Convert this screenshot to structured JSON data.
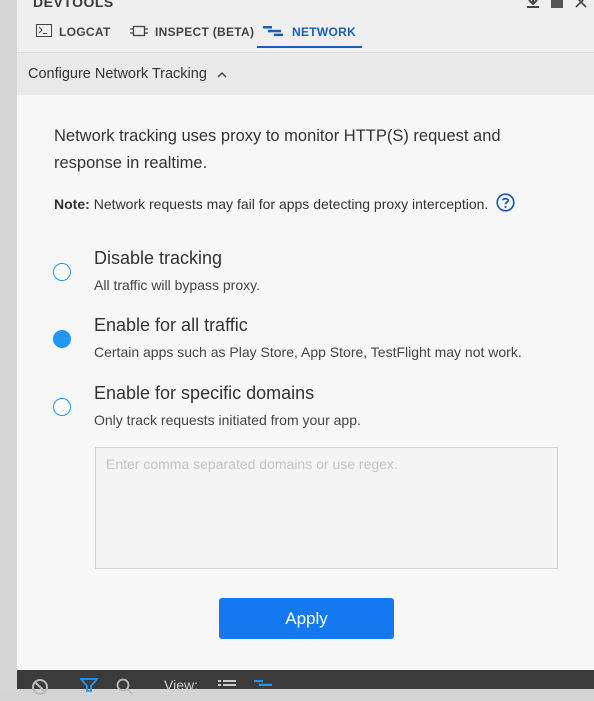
{
  "window": {
    "title": "DEVTOOLS",
    "controls": [
      "download-icon",
      "maximize-icon",
      "close-icon"
    ]
  },
  "tabs": [
    {
      "label": "LOGCAT",
      "icon": "terminal-icon",
      "active": false
    },
    {
      "label": "INSPECT (BETA)",
      "icon": "chip-icon",
      "active": false
    },
    {
      "label": "NETWORK",
      "icon": "network-icon",
      "active": true
    }
  ],
  "config": {
    "header": "Configure Network Tracking",
    "expanded": true,
    "description": "Network tracking uses proxy to monitor HTTP(S) request and response in realtime.",
    "note_label": "Note:",
    "note_text": "Network requests may fail for apps detecting proxy interception.",
    "options": [
      {
        "title": "Disable tracking",
        "subtitle": "All traffic will bypass proxy.",
        "selected": false
      },
      {
        "title": "Enable for all traffic",
        "subtitle": "Certain apps such as Play Store, App Store, TestFlight may not work.",
        "selected": true
      },
      {
        "title": "Enable for specific domains",
        "subtitle": "Only track requests initiated from your app.",
        "selected": false
      }
    ],
    "domains_placeholder": "Enter comma separated domains or use regex.",
    "domains_value": "",
    "apply_label": "Apply"
  },
  "bottom_bar": {
    "view_label": "View:",
    "icons": [
      "block-icon",
      "filter-icon",
      "search-icon",
      "list-view-icon",
      "waterfall-view-icon"
    ]
  },
  "colors": {
    "accent": "#1479f0",
    "tab_active": "#1a5fb4",
    "radio": "#2196f3",
    "bottom_bar": "#3b3b3b"
  }
}
